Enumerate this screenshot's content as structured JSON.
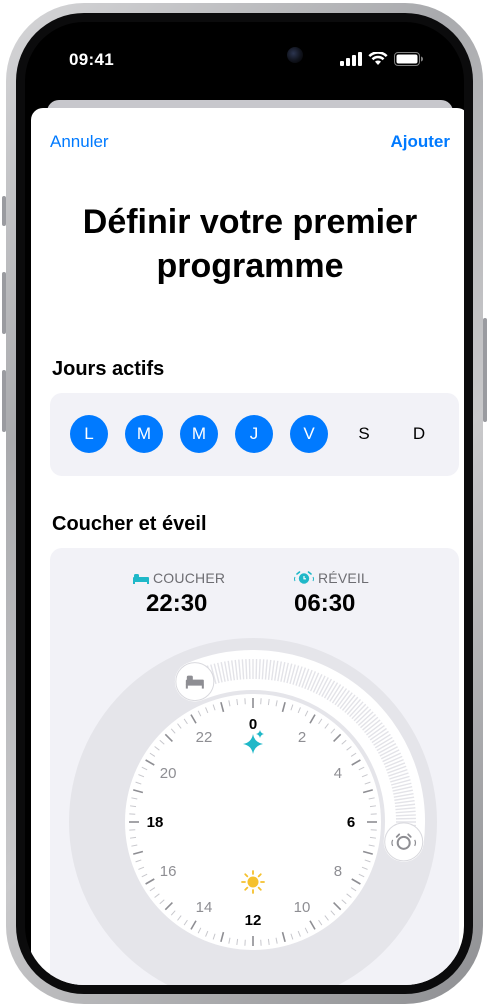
{
  "status_bar": {
    "time": "09:41"
  },
  "nav": {
    "cancel": "Annuler",
    "add": "Ajouter"
  },
  "title": {
    "line1": "Définir votre premier",
    "line2": "programme"
  },
  "days": {
    "label": "Jours actifs",
    "items": [
      {
        "letter": "L",
        "active": true
      },
      {
        "letter": "M",
        "active": true
      },
      {
        "letter": "M",
        "active": true
      },
      {
        "letter": "J",
        "active": true
      },
      {
        "letter": "V",
        "active": true
      },
      {
        "letter": "S",
        "active": false
      },
      {
        "letter": "D",
        "active": false
      }
    ]
  },
  "schedule": {
    "label": "Coucher et éveil",
    "bedtime": {
      "label": "COUCHER",
      "time": "22:30",
      "icon": "bed-icon"
    },
    "wake": {
      "label": "RÉVEIL",
      "time": "06:30",
      "icon": "alarm-icon"
    },
    "clock_numbers": [
      "0",
      "2",
      "4",
      "6",
      "8",
      "10",
      "12",
      "14",
      "16",
      "18",
      "20",
      "22"
    ],
    "midnight_icon": "sparkles-icon",
    "noon_icon": "sun-icon",
    "colors": {
      "accent": "#007aff",
      "teal": "#1fb8c8",
      "sun": "#f5c12e"
    }
  }
}
